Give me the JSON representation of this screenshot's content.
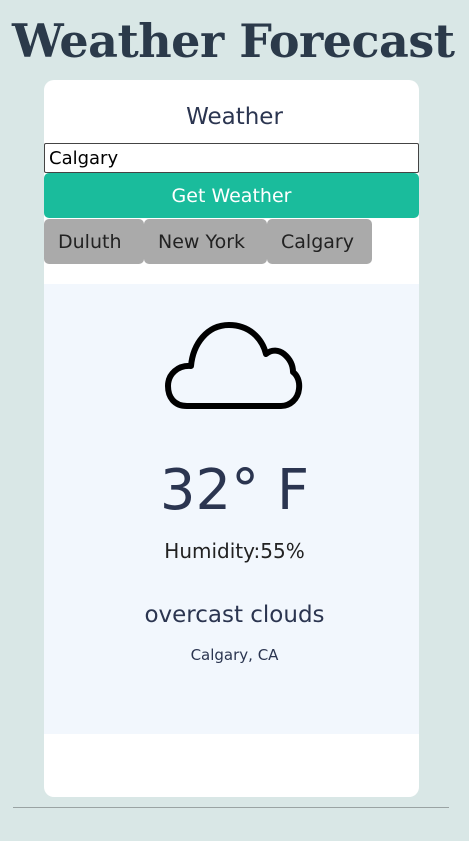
{
  "page": {
    "title": "Weather Forecast"
  },
  "card": {
    "heading": "Weather",
    "city_input_value": "Calgary",
    "get_weather_label": "Get Weather",
    "city_buttons": [
      "Duluth",
      "New York",
      "Calgary"
    ]
  },
  "forecast": {
    "icon": "cloud-icon",
    "temperature": "32° F",
    "humidity_label": "Humidity:",
    "humidity_value": "55%",
    "description": "overcast clouds",
    "location": "Calgary, CA"
  },
  "colors": {
    "background": "#d9e7e6",
    "accent": "#1abc9c",
    "chip": "#aaaaaa",
    "panel": "#f2f7fd",
    "text": "#2b3550"
  }
}
